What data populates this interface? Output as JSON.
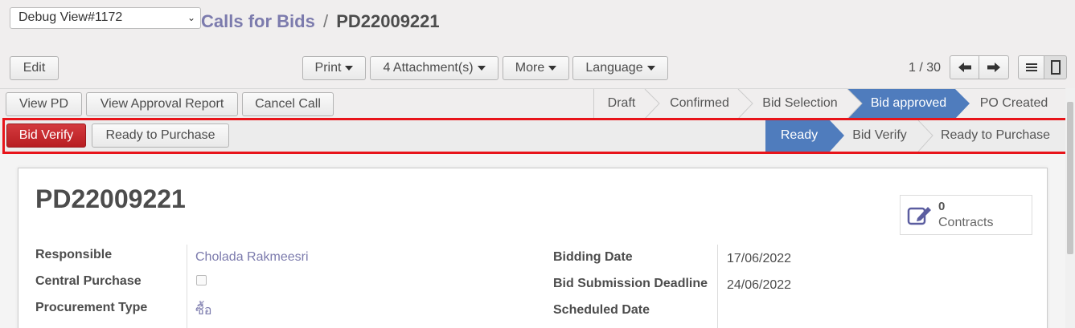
{
  "debug": {
    "selected": "Debug View#1172"
  },
  "breadcrumb": {
    "parent": "Calls for Bids",
    "separator": "/",
    "current": "PD22009221"
  },
  "toolbar": {
    "edit": "Edit",
    "print": "Print",
    "attachments": "4 Attachment(s)",
    "more": "More",
    "language": "Language"
  },
  "pager": {
    "value": "1 / 30"
  },
  "actions_row1": {
    "view_pd": "View PD",
    "view_approval_report": "View Approval Report",
    "cancel_call": "Cancel Call"
  },
  "stages_row1": [
    "Draft",
    "Confirmed",
    "Bid Selection",
    "Bid approved",
    "PO Created"
  ],
  "stages_row1_active": "Bid approved",
  "actions_row2": {
    "bid_verify": "Bid Verify",
    "ready_to_purchase": "Ready to Purchase"
  },
  "stages_row2": [
    "Ready",
    "Bid Verify",
    "Ready to Purchase"
  ],
  "stages_row2_active": "Ready",
  "form": {
    "title": "PD22009221",
    "contracts": {
      "count": "0",
      "label": "Contracts"
    },
    "left": [
      {
        "label": "Responsible",
        "value": "Cholada Rakmeesri"
      },
      {
        "label": "Central Purchase",
        "value": ""
      },
      {
        "label": "Procurement Type",
        "value": "ซื้อ"
      }
    ],
    "right": [
      {
        "label": "Bidding Date",
        "value": "17/06/2022"
      },
      {
        "label": "Bid Submission Deadline",
        "value": "24/06/2022"
      },
      {
        "label": "Scheduled Date",
        "value": ""
      }
    ]
  },
  "colors": {
    "accent": "#7c7bad",
    "active_stage": "#4f7cbd",
    "danger": "#c9252a",
    "highlight": "#e8141a"
  }
}
